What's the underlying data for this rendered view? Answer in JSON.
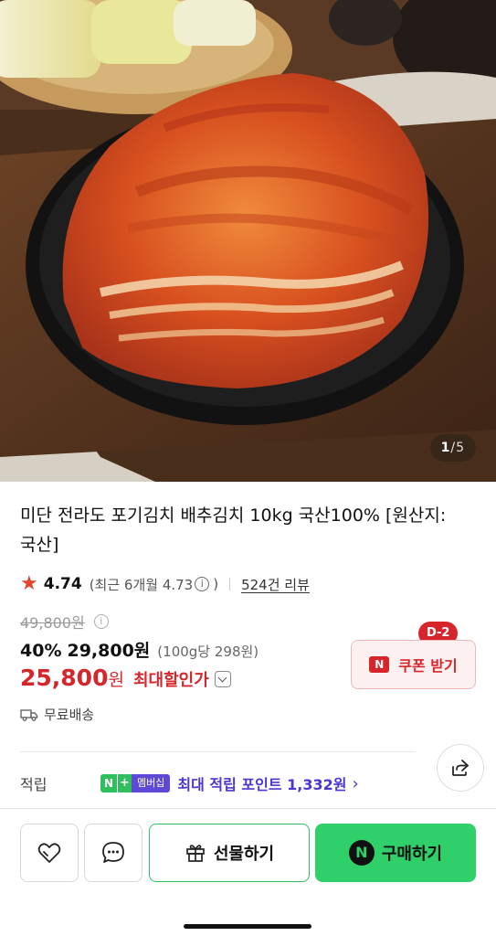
{
  "hero": {
    "page_current": "1",
    "page_separator": "/",
    "page_total": "5"
  },
  "product": {
    "title": "미단 전라도 포기김치 배추김치 10kg 국산100% [원산지:국산]",
    "rating": "4.74",
    "recent_rating": "(최근 6개월 4.73",
    "recent_close": ")",
    "info_icon": "i",
    "review_count": "524건 리뷰",
    "original_price": "49,800원",
    "discount_rate": "40%",
    "discount_price": "29,800원",
    "unit_price": "(100g당 298원)",
    "final_price": "25,800",
    "final_currency": "원",
    "final_label": "최대할인가",
    "shipping": "무료배송"
  },
  "coupon": {
    "badge": "D-2",
    "logo": "N",
    "label": "쿠폰 받기"
  },
  "points": {
    "label": "적립",
    "badge_n": "N",
    "badge_plus": "+",
    "badge_membership": "멤버십",
    "text": "최대 적립 포인트 1,332원",
    "chevron": "›"
  },
  "bottom": {
    "gift_label": "선물하기",
    "buy_logo": "N",
    "buy_label": "구매하기"
  },
  "colors": {
    "accent_red": "#d6262b",
    "naver_green": "#2fd06a",
    "membership_purple": "#4a36d2"
  },
  "icons": [
    "star-icon",
    "info-icon",
    "chevron-down-icon",
    "truck-icon",
    "share-icon",
    "heart-icon",
    "chat-icon",
    "gift-icon"
  ]
}
